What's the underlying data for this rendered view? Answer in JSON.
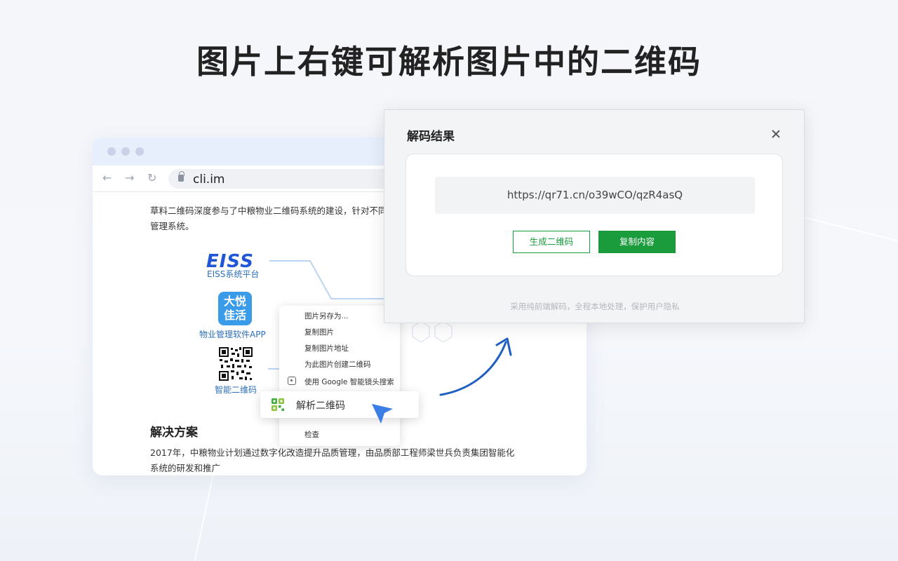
{
  "headline": "图片上右键可解析图片中的二维码",
  "browser": {
    "url": "cli.im",
    "paragraph_line1": "草料二维码深度参与了中粮物业二维码系统的建设，针对不同",
    "paragraph_line2": "管理系统。",
    "nodes": {
      "eiss_logo": "EISS",
      "eiss_label": "EISS系统平台",
      "app_icon_text": "大悦\n佳活",
      "app_label": "物业管理软件APP",
      "qr_label": "智能二维码"
    },
    "section_title": "解决方案",
    "bottom_line1": "2017年，中粮物业计划通过数字化改造提升品质管理，由品质部工程师梁世兵负责集团智能化",
    "bottom_line2": "系统的研发和推广"
  },
  "context_menu": {
    "items": [
      "图片另存为...",
      "复制图片",
      "复制图片地址",
      "为此图片创建二维码",
      "使用 Google 智能镜头搜索"
    ],
    "highlighted": "解析二维码",
    "last_item": "检查"
  },
  "dialog": {
    "title": "解码结果",
    "result_text": "https://qr71.cn/o39wCO/qzR4asQ",
    "generate_button": "生成二维码",
    "copy_button": "复制内容",
    "footnote": "采用纯前端解码，全程本地处理，保护用户隐私"
  },
  "colors": {
    "accent_green": "#1a9b3c",
    "link_blue": "#2c6fb8",
    "arrow_blue": "#1f5fbf"
  }
}
